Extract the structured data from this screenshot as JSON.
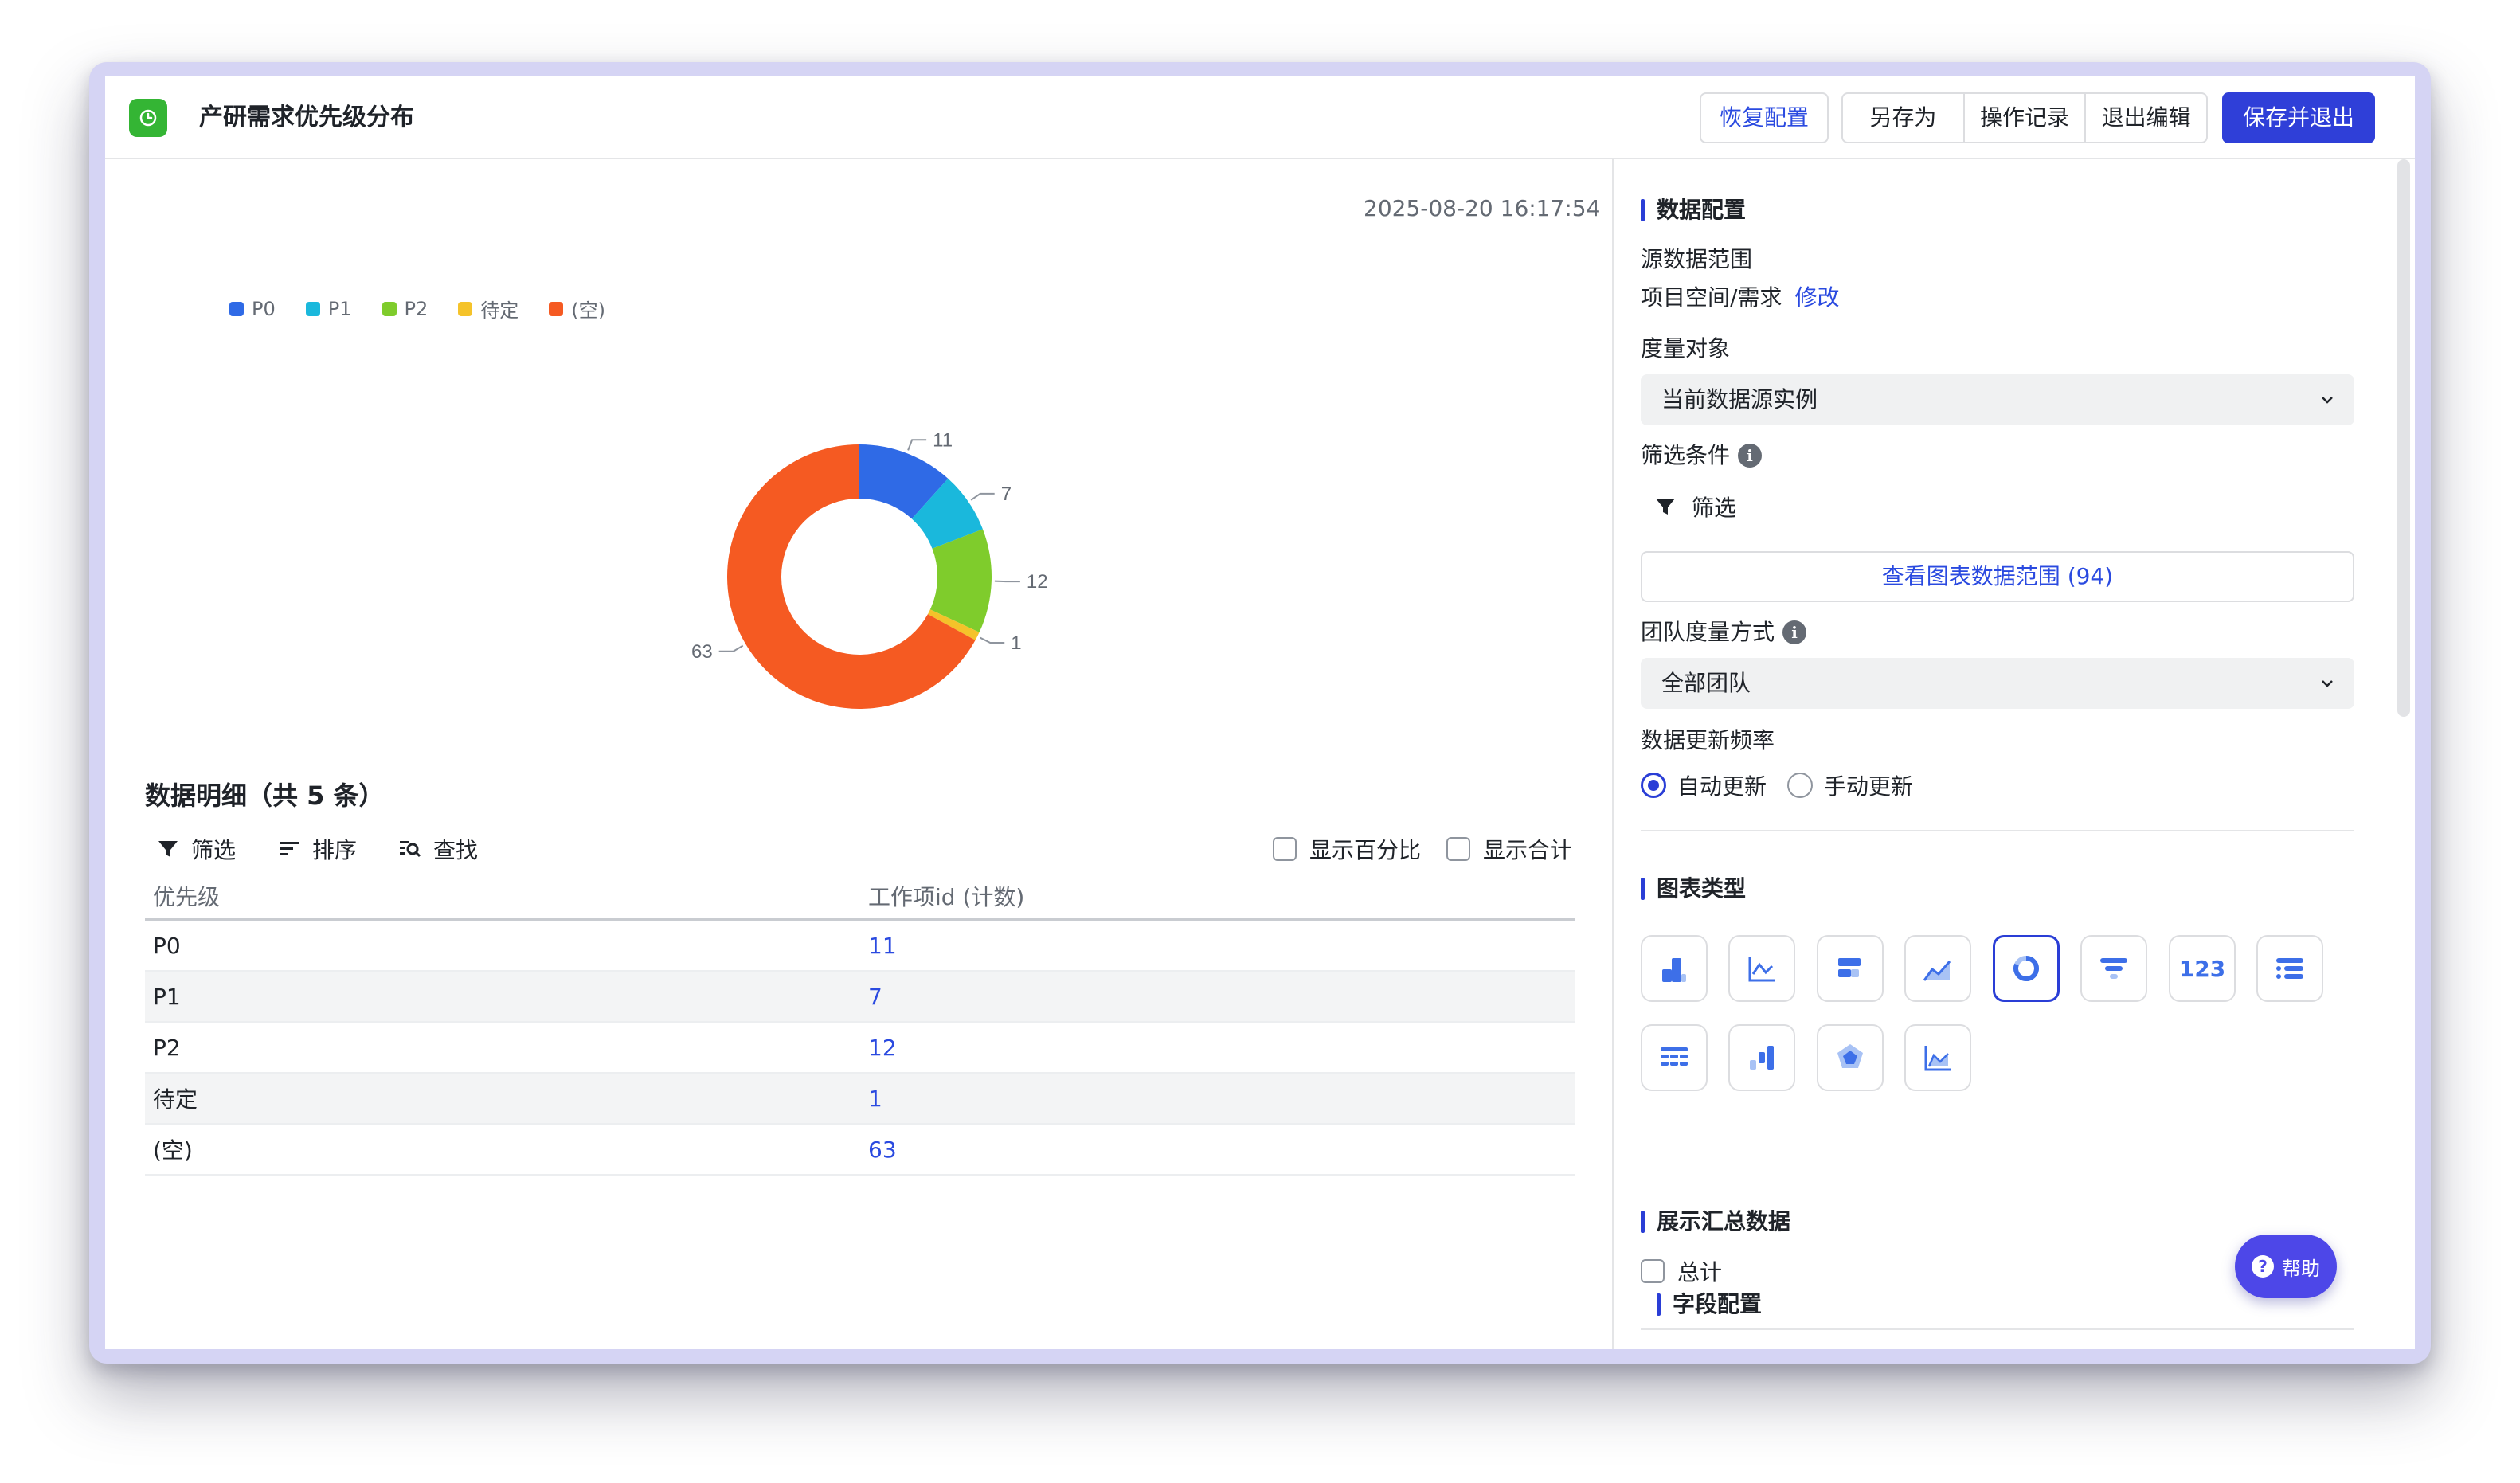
{
  "header": {
    "title": "产研需求优先级分布",
    "restore_label": "恢复配置",
    "save_as_label": "另存为",
    "history_label": "操作记录",
    "exit_edit_label": "退出编辑",
    "save_exit_label": "保存并退出"
  },
  "left": {
    "timestamp": "2025-08-20 16:17:54",
    "legend": [
      {
        "label": "P0",
        "color": "#2f6ae6"
      },
      {
        "label": "P1",
        "color": "#1ab8dc"
      },
      {
        "label": "P2",
        "color": "#7fcc2c"
      },
      {
        "label": "待定",
        "color": "#f5c32a"
      },
      {
        "label": "(空)",
        "color": "#f55a22"
      }
    ],
    "section_title": "数据明细（共 5 条）",
    "toolbar": {
      "filter": "筛选",
      "sort": "排序",
      "find": "查找"
    },
    "show_percent": "显示百分比",
    "show_total": "显示合计",
    "table": {
      "headers": [
        "优先级",
        "工作项id (计数)"
      ],
      "rows": [
        [
          "P0",
          "11"
        ],
        [
          "P1",
          "7"
        ],
        [
          "P2",
          "12"
        ],
        [
          "待定",
          "1"
        ],
        [
          "(空)",
          "63"
        ]
      ]
    }
  },
  "chart_data": {
    "type": "pie",
    "categories": [
      "P0",
      "P1",
      "P2",
      "待定",
      "(空)"
    ],
    "values": [
      11,
      7,
      12,
      1,
      63
    ],
    "colors": [
      "#2f6ae6",
      "#1ab8dc",
      "#7fcc2c",
      "#f5c32a",
      "#f55a22"
    ],
    "donut": true,
    "legend_position": "top-left"
  },
  "right": {
    "data_config": "数据配置",
    "source_label": "源数据范围",
    "source_value": "项目空间/需求",
    "source_edit": "修改",
    "measure_label": "度量对象",
    "measure_value": "当前数据源实例",
    "filter_label": "筛选条件",
    "filter_btn": "筛选",
    "view_range": "查看图表数据范围 (94)",
    "team_label": "团队度量方式",
    "team_value": "全部团队",
    "freq_label": "数据更新频率",
    "freq_auto": "自动更新",
    "freq_manual": "手动更新",
    "chart_type_label": "图表类型",
    "summary_label": "展示汇总数据",
    "total_label": "总计",
    "field_config": "字段配置",
    "help": "帮助",
    "chart_type_123": "123",
    "accent": "#2a3ed6"
  }
}
